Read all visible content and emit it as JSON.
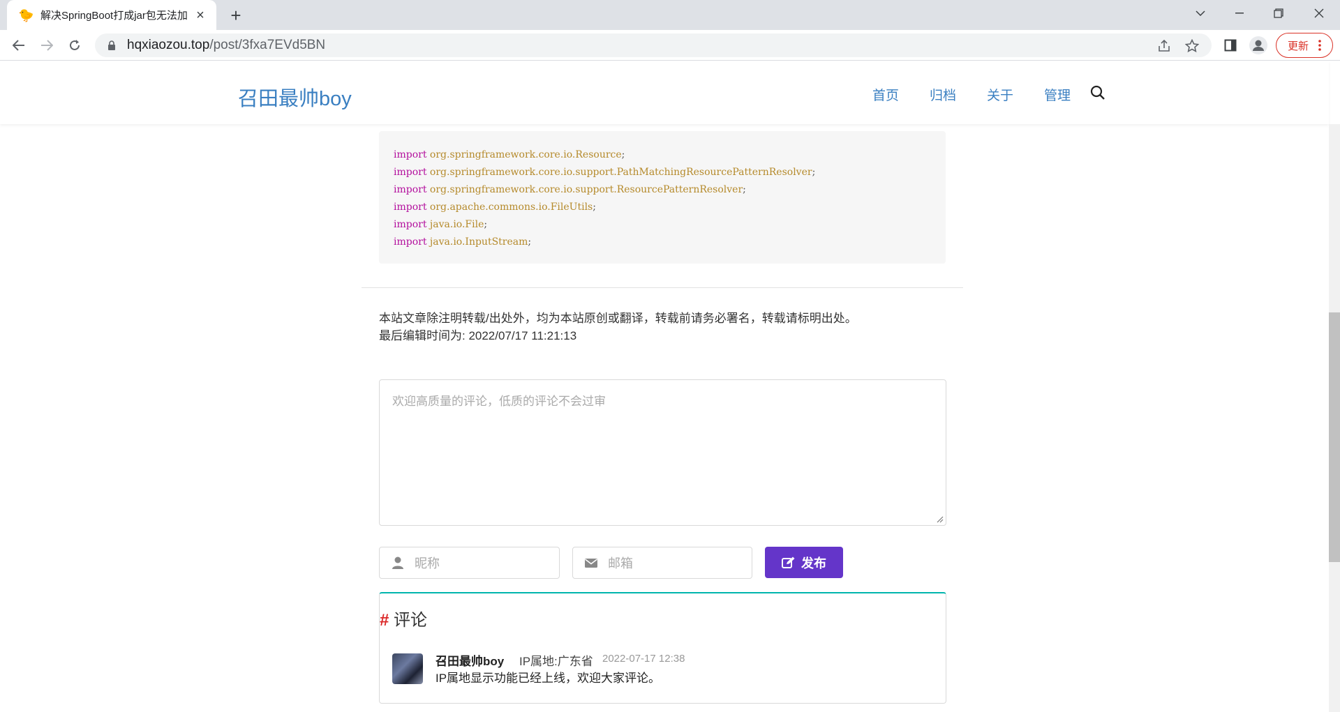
{
  "browser": {
    "tab_title": "解决SpringBoot打成jar包无法加",
    "tab_favicon": "🐤",
    "url_host": "hqxiaozou.top",
    "url_path": "/post/3fxa7EVd5BN",
    "update_label": "更新"
  },
  "site": {
    "logo": "召田最帅boy",
    "nav": [
      "首页",
      "归档",
      "关于",
      "管理"
    ]
  },
  "code": {
    "lines": [
      {
        "kw": "import",
        "path": "org.springframework.core.io.Resource"
      },
      {
        "kw": "import",
        "path": "org.springframework.core.io.support.PathMatchingResourcePatternResolver"
      },
      {
        "kw": "import",
        "path": "org.springframework.core.io.support.ResourcePatternResolver"
      },
      {
        "kw": "import",
        "path": "org.apache.commons.io.FileUtils"
      },
      {
        "kw": "import",
        "path": "java.io.File"
      },
      {
        "kw": "import",
        "path": "java.io.InputStream"
      }
    ]
  },
  "article_footer": {
    "copyright": "本站文章除注明转载/出处外，均为本站原创或翻译，转载前请务必署名，转载请标明出处。",
    "last_edited": "最后编辑时间为: 2022/07/17 11:21:13"
  },
  "comment_form": {
    "textarea_placeholder": "欢迎高质量的评论，低质的评论不会过审",
    "nickname_placeholder": "昵称",
    "email_placeholder": "邮箱",
    "publish_label": "发布"
  },
  "comments": {
    "title_hash": "#",
    "title": "评论",
    "items": [
      {
        "author": "召田最帅boy",
        "ip_location": "IP属地:广东省",
        "time": "2022-07-17 12:38",
        "text": "IP属地显示功能已经上线，欢迎大家评论。"
      }
    ]
  },
  "colors": {
    "link": "#3a7fc1",
    "publish": "#6435c9",
    "comment_accent": "#00b5ad"
  }
}
